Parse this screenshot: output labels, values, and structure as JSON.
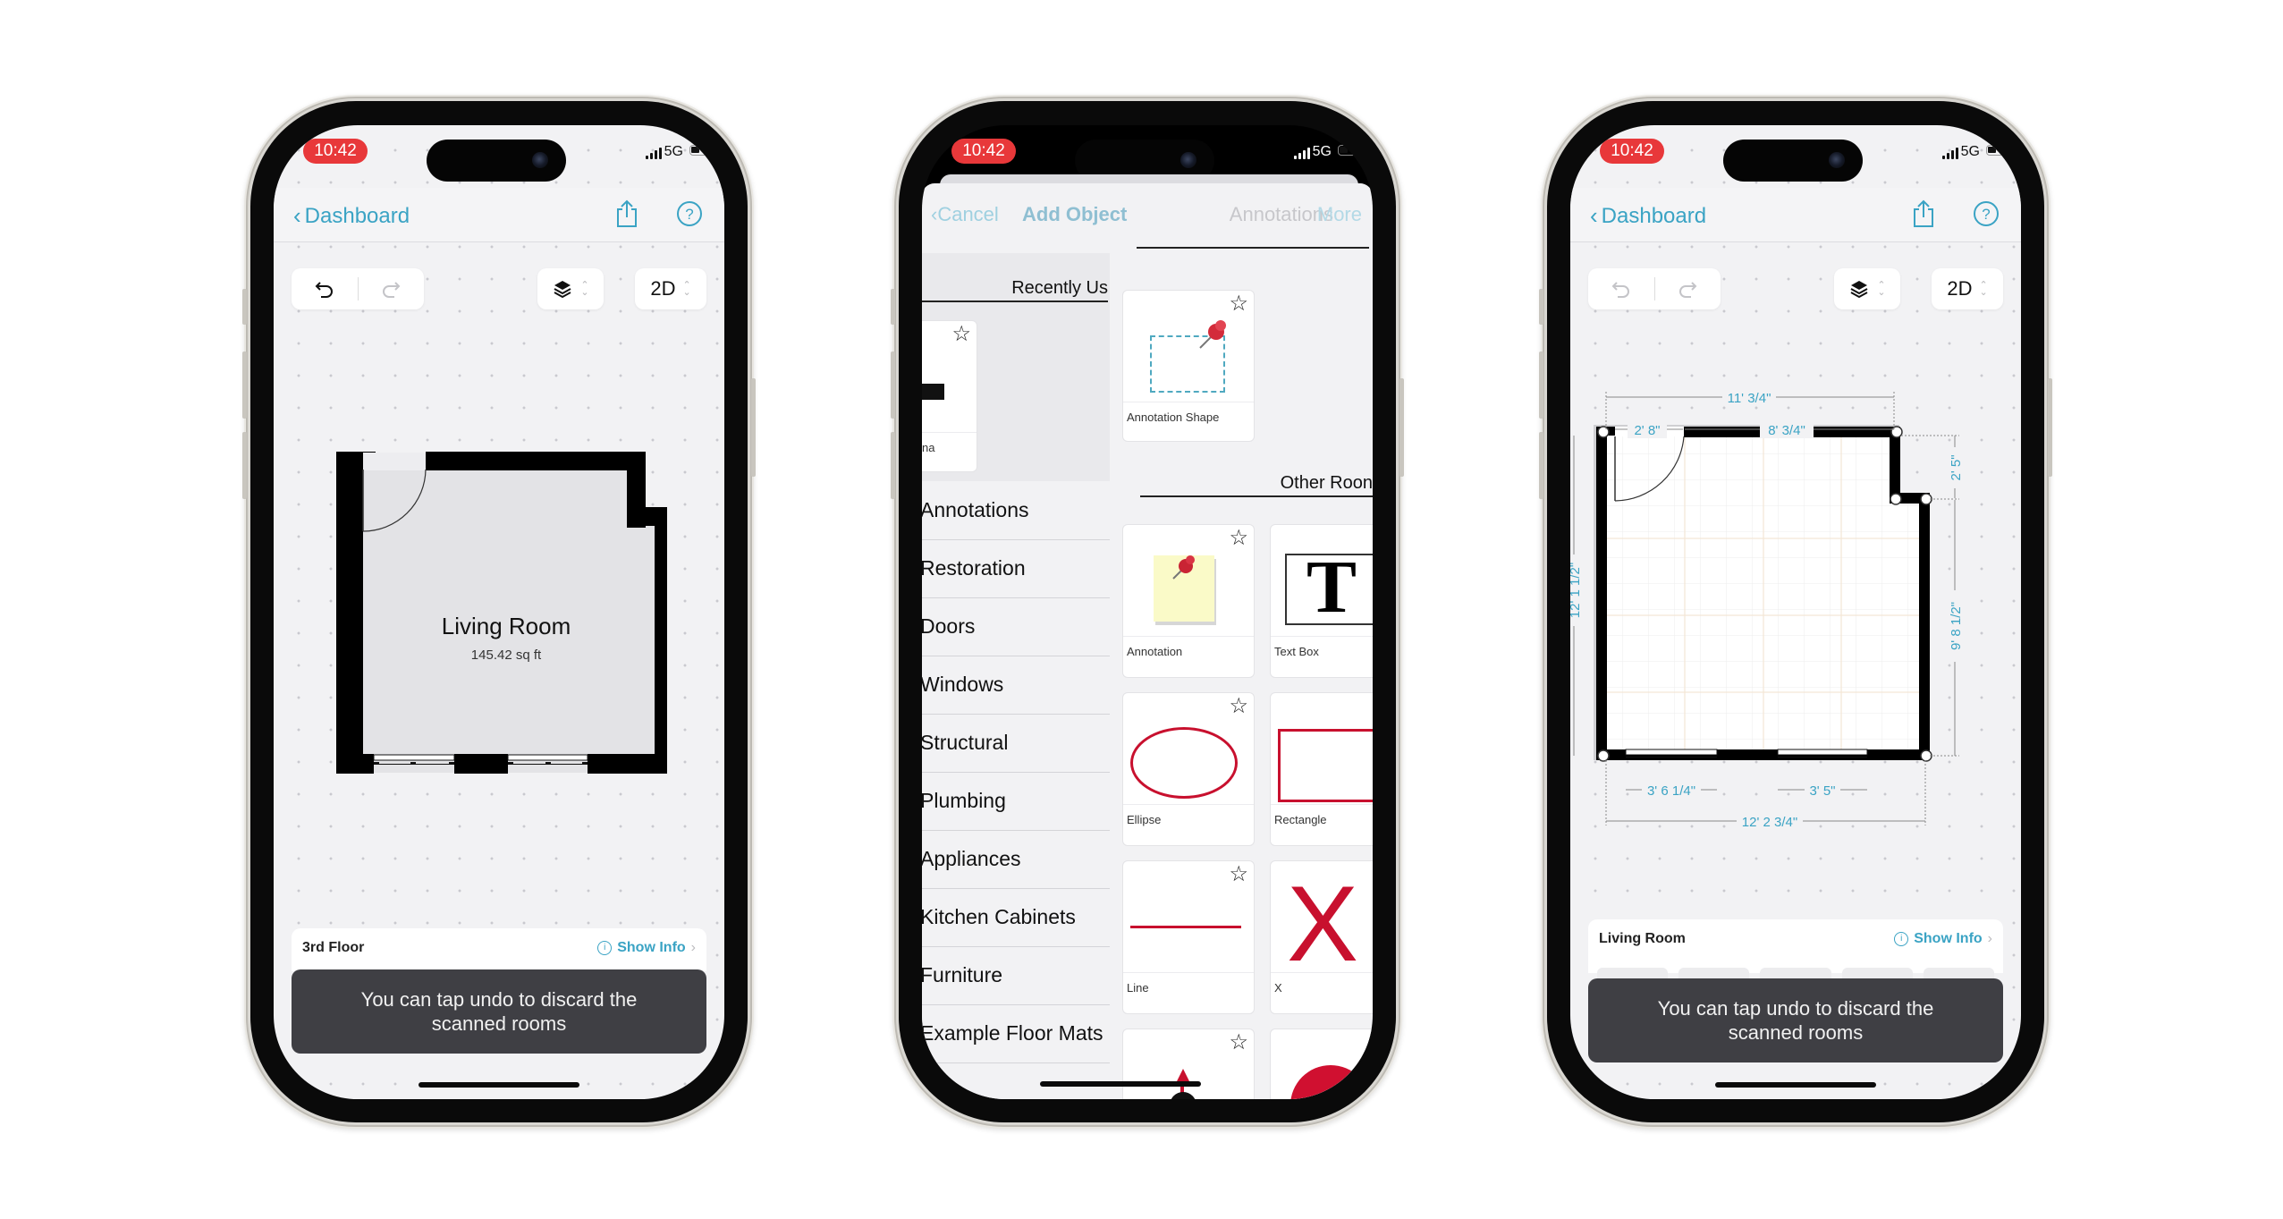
{
  "phones": [
    {
      "status": {
        "time": "10:42",
        "network": "5G"
      },
      "nav": {
        "back_label": "Dashboard"
      },
      "toolbar": {
        "view_mode": "2D"
      },
      "floorplan": {
        "room_name": "Living Room",
        "area": "145.42 sq ft"
      },
      "bottom_card": {
        "title": "3rd Floor",
        "info_label": "Show Info"
      },
      "toast": "You can tap undo to discard the scanned rooms"
    },
    {
      "status": {
        "time": "10:42",
        "network": "5G"
      },
      "sheet_nav": {
        "cancel_label": "Cancel",
        "title": "Add Object",
        "right_label": "Annotations",
        "more_label": "More"
      },
      "recent": {
        "header": "Recently Us",
        "partial_tile_label": "na"
      },
      "categories": [
        "Annotations",
        "Restoration",
        "Doors",
        "Windows",
        "Structural",
        "Plumbing",
        "Appliances",
        "Kitchen Cabinets",
        "Furniture",
        "Example Floor Mats"
      ],
      "grid": {
        "top_tile": "Annotation Shape",
        "section_header": "Other Roon",
        "tiles": [
          "Annotation",
          "Text Box",
          "Ellipse",
          "Rectangle",
          "Line",
          "X"
        ]
      }
    },
    {
      "status": {
        "time": "10:42",
        "network": "5G"
      },
      "nav": {
        "back_label": "Dashboard"
      },
      "toolbar": {
        "view_mode": "2D"
      },
      "dimensions": {
        "top_overall": "11' 3/4\"",
        "top_door": "2' 8\"",
        "top_wall": "8' 3/4\"",
        "left": "12' 1 1/2\"",
        "right_upper": "2' 5\"",
        "right_lower": "9' 8 1/2\"",
        "bottom_window_1": "3' 6 1/4\"",
        "bottom_window_2": "3' 5\"",
        "bottom_overall": "12' 2 3/4\""
      },
      "bottom_card": {
        "title": "Living Room",
        "info_label": "Show Info"
      },
      "toast": "You can tap undo to discard the scanned rooms"
    }
  ],
  "colors": {
    "accent": "#3aa3c4",
    "time_pill": "#e8383a",
    "toast_bg": "#3f3f44",
    "annotation_red": "#c8102e"
  }
}
